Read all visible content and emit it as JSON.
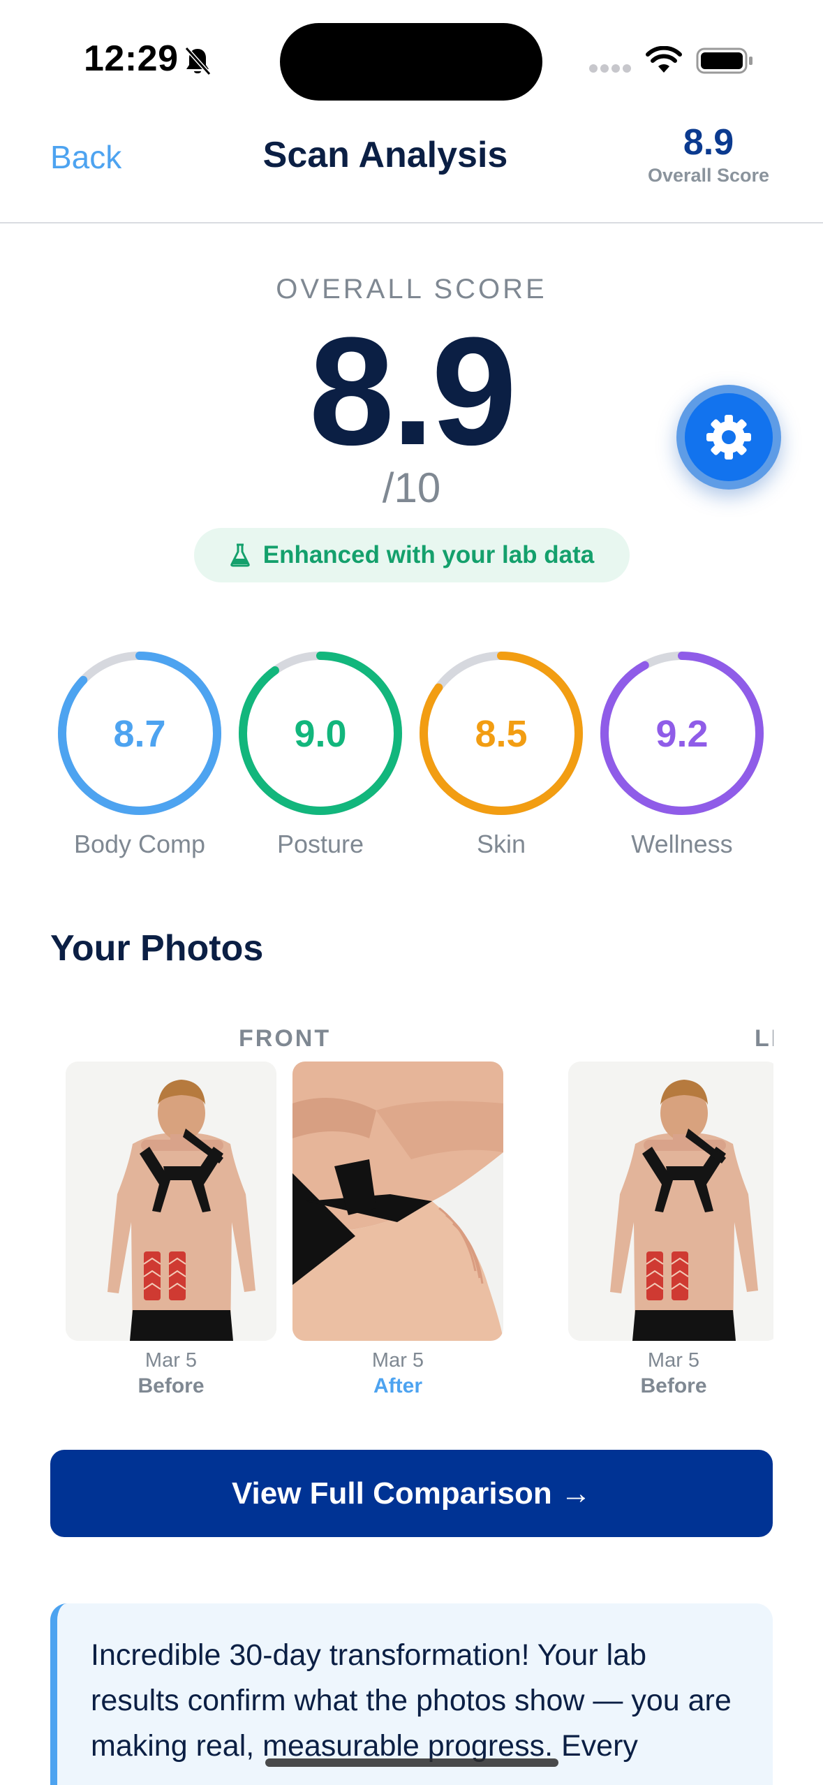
{
  "status_bar": {
    "time": "12:29"
  },
  "nav": {
    "back_label": "Back",
    "title": "Scan Analysis",
    "score_value": "8.9",
    "score_label": "Overall Score"
  },
  "score": {
    "caption": "OVERALL SCORE",
    "value": "8.9",
    "out_of": "/10",
    "lab_badge": "Enhanced with your lab data"
  },
  "metrics": [
    {
      "value": "8.7",
      "label": "Body Comp",
      "fraction": 0.87,
      "color": "#4da3f0"
    },
    {
      "value": "9.0",
      "label": "Posture",
      "fraction": 0.9,
      "color": "#12b67c"
    },
    {
      "value": "8.5",
      "label": "Skin",
      "fraction": 0.85,
      "color": "#f29d12"
    },
    {
      "value": "9.2",
      "label": "Wellness",
      "fraction": 0.92,
      "color": "#8f5ce8"
    }
  ],
  "ring_track_color": "#d6d8de",
  "photos_section": {
    "title": "Your Photos",
    "groups": [
      {
        "label": "FRONT",
        "photos": [
          {
            "date": "Mar 5",
            "tag": "Before"
          },
          {
            "date": "Mar 5",
            "tag": "After"
          }
        ]
      },
      {
        "label": "LEFT",
        "photos": [
          {
            "date": "Mar 5",
            "tag": "Before"
          }
        ]
      }
    ]
  },
  "cta_label": "View Full Comparison →",
  "insight_text": "Incredible 30-day transformation! Your lab results confirm what the photos show — you are making real, measurable progress. Every"
}
